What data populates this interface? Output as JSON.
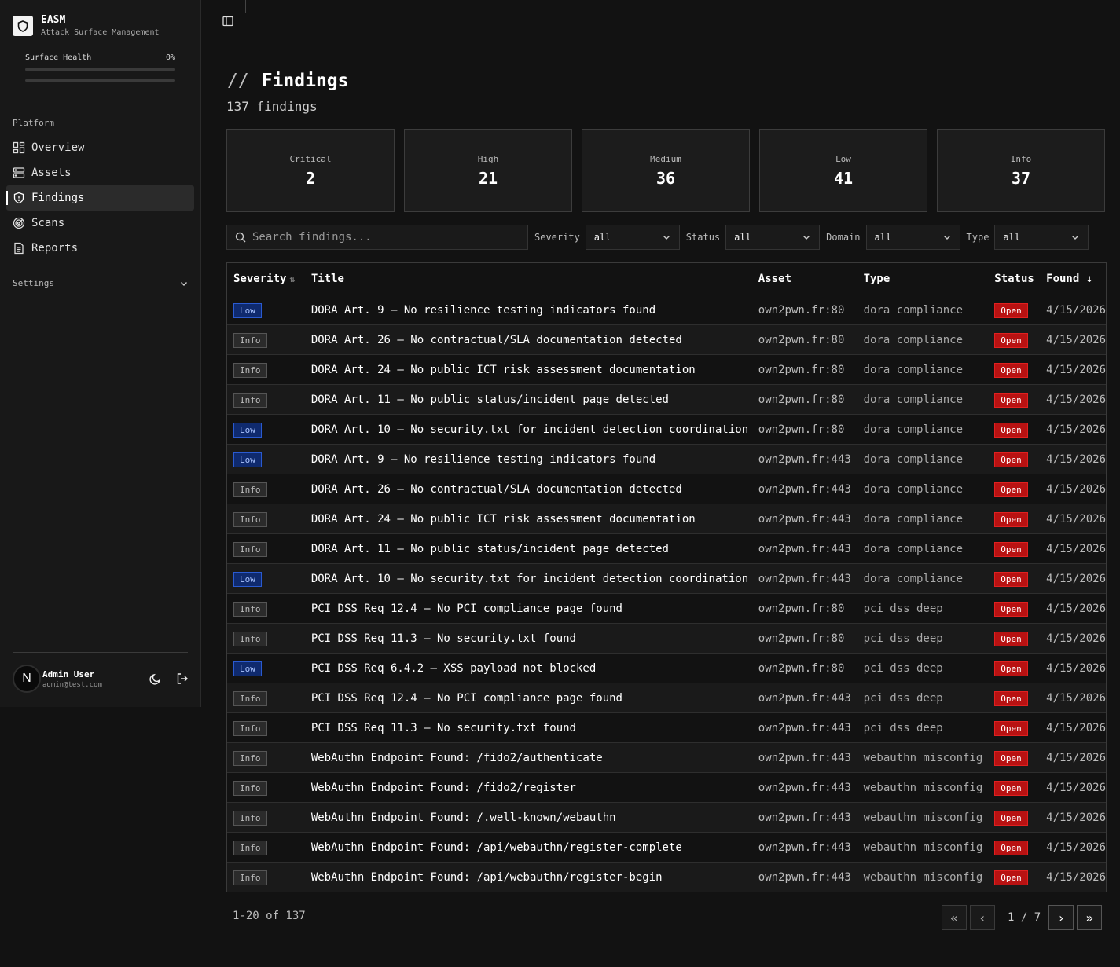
{
  "app": {
    "name": "EASM",
    "subtitle": "Attack Surface Management"
  },
  "health": {
    "label": "Surface Health",
    "value": "0%",
    "progress": 0
  },
  "sidebar": {
    "section": "Platform",
    "items": [
      {
        "label": "Overview",
        "icon": "grid-icon"
      },
      {
        "label": "Assets",
        "icon": "server-icon"
      },
      {
        "label": "Findings",
        "icon": "shield-icon",
        "active": true
      },
      {
        "label": "Scans",
        "icon": "radar-icon"
      },
      {
        "label": "Reports",
        "icon": "file-icon"
      }
    ],
    "settings": "Settings"
  },
  "user": {
    "initial": "N",
    "name": "Admin User",
    "email": "admin@test.com"
  },
  "page": {
    "title": "Findings",
    "count": "137 findings"
  },
  "cards": [
    {
      "label": "Critical",
      "value": "2"
    },
    {
      "label": "High",
      "value": "21"
    },
    {
      "label": "Medium",
      "value": "36"
    },
    {
      "label": "Low",
      "value": "41"
    },
    {
      "label": "Info",
      "value": "37"
    }
  ],
  "filters": {
    "search_placeholder": "Search findings...",
    "severity": {
      "label": "Severity",
      "value": "all"
    },
    "status": {
      "label": "Status",
      "value": "all"
    },
    "domain": {
      "label": "Domain",
      "value": "all"
    },
    "type": {
      "label": "Type",
      "value": "all"
    }
  },
  "table": {
    "headers": {
      "severity": "Severity",
      "title": "Title",
      "asset": "Asset",
      "type": "Type",
      "status": "Status",
      "found": "Found"
    },
    "rows": [
      {
        "sev": "Low",
        "title": "DORA Art. 9 — No resilience testing indicators found",
        "asset": "own2pwn.fr:80",
        "type": "dora compliance",
        "status": "Open",
        "found": "4/15/2026"
      },
      {
        "sev": "Info",
        "title": "DORA Art. 26 — No contractual/SLA documentation detected",
        "asset": "own2pwn.fr:80",
        "type": "dora compliance",
        "status": "Open",
        "found": "4/15/2026"
      },
      {
        "sev": "Info",
        "title": "DORA Art. 24 — No public ICT risk assessment documentation",
        "asset": "own2pwn.fr:80",
        "type": "dora compliance",
        "status": "Open",
        "found": "4/15/2026"
      },
      {
        "sev": "Info",
        "title": "DORA Art. 11 — No public status/incident page detected",
        "asset": "own2pwn.fr:80",
        "type": "dora compliance",
        "status": "Open",
        "found": "4/15/2026"
      },
      {
        "sev": "Low",
        "title": "DORA Art. 10 — No security.txt for incident detection coordination",
        "asset": "own2pwn.fr:80",
        "type": "dora compliance",
        "status": "Open",
        "found": "4/15/2026"
      },
      {
        "sev": "Low",
        "title": "DORA Art. 9 — No resilience testing indicators found",
        "asset": "own2pwn.fr:443",
        "type": "dora compliance",
        "status": "Open",
        "found": "4/15/2026"
      },
      {
        "sev": "Info",
        "title": "DORA Art. 26 — No contractual/SLA documentation detected",
        "asset": "own2pwn.fr:443",
        "type": "dora compliance",
        "status": "Open",
        "found": "4/15/2026"
      },
      {
        "sev": "Info",
        "title": "DORA Art. 24 — No public ICT risk assessment documentation",
        "asset": "own2pwn.fr:443",
        "type": "dora compliance",
        "status": "Open",
        "found": "4/15/2026"
      },
      {
        "sev": "Info",
        "title": "DORA Art. 11 — No public status/incident page detected",
        "asset": "own2pwn.fr:443",
        "type": "dora compliance",
        "status": "Open",
        "found": "4/15/2026"
      },
      {
        "sev": "Low",
        "title": "DORA Art. 10 — No security.txt for incident detection coordination",
        "asset": "own2pwn.fr:443",
        "type": "dora compliance",
        "status": "Open",
        "found": "4/15/2026"
      },
      {
        "sev": "Info",
        "title": "PCI DSS Req 12.4 — No PCI compliance page found",
        "asset": "own2pwn.fr:80",
        "type": "pci dss deep",
        "status": "Open",
        "found": "4/15/2026"
      },
      {
        "sev": "Info",
        "title": "PCI DSS Req 11.3 — No security.txt found",
        "asset": "own2pwn.fr:80",
        "type": "pci dss deep",
        "status": "Open",
        "found": "4/15/2026"
      },
      {
        "sev": "Low",
        "title": "PCI DSS Req 6.4.2 — XSS payload not blocked",
        "asset": "own2pwn.fr:80",
        "type": "pci dss deep",
        "status": "Open",
        "found": "4/15/2026"
      },
      {
        "sev": "Info",
        "title": "PCI DSS Req 12.4 — No PCI compliance page found",
        "asset": "own2pwn.fr:443",
        "type": "pci dss deep",
        "status": "Open",
        "found": "4/15/2026"
      },
      {
        "sev": "Info",
        "title": "PCI DSS Req 11.3 — No security.txt found",
        "asset": "own2pwn.fr:443",
        "type": "pci dss deep",
        "status": "Open",
        "found": "4/15/2026"
      },
      {
        "sev": "Info",
        "title": "WebAuthn Endpoint Found: /fido2/authenticate",
        "asset": "own2pwn.fr:443",
        "type": "webauthn misconfig",
        "status": "Open",
        "found": "4/15/2026"
      },
      {
        "sev": "Info",
        "title": "WebAuthn Endpoint Found: /fido2/register",
        "asset": "own2pwn.fr:443",
        "type": "webauthn misconfig",
        "status": "Open",
        "found": "4/15/2026"
      },
      {
        "sev": "Info",
        "title": "WebAuthn Endpoint Found: /.well-known/webauthn",
        "asset": "own2pwn.fr:443",
        "type": "webauthn misconfig",
        "status": "Open",
        "found": "4/15/2026"
      },
      {
        "sev": "Info",
        "title": "WebAuthn Endpoint Found: /api/webauthn/register-complete",
        "asset": "own2pwn.fr:443",
        "type": "webauthn misconfig",
        "status": "Open",
        "found": "4/15/2026"
      },
      {
        "sev": "Info",
        "title": "WebAuthn Endpoint Found: /api/webauthn/register-begin",
        "asset": "own2pwn.fr:443",
        "type": "webauthn misconfig",
        "status": "Open",
        "found": "4/15/2026"
      }
    ]
  },
  "pagination": {
    "range": "1-20 of 137",
    "page": "1 / 7"
  },
  "colors": {
    "low_badge": "#0f2a6e",
    "open_badge": "#b81212",
    "background": "#121212",
    "sidebar": "#181818"
  }
}
